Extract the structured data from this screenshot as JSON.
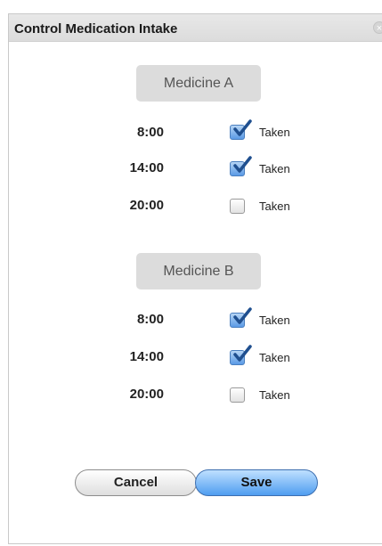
{
  "window": {
    "title": "Control Medication Intake",
    "close_symbol": "×"
  },
  "medicines": [
    {
      "name": "Medicine A",
      "doses": [
        {
          "time": "8:00",
          "label": "Taken",
          "checked": true
        },
        {
          "time": "14:00",
          "label": "Taken",
          "checked": true
        },
        {
          "time": "20:00",
          "label": "Taken",
          "checked": false
        }
      ]
    },
    {
      "name": "Medicine B",
      "doses": [
        {
          "time": "8:00",
          "label": "Taken",
          "checked": true
        },
        {
          "time": "14:00",
          "label": "Taken",
          "checked": true
        },
        {
          "time": "20:00",
          "label": "Taken",
          "checked": false
        }
      ]
    }
  ],
  "buttons": {
    "cancel_label": "Cancel",
    "save_label": "Save"
  },
  "colors": {
    "accent": "#4f9df0",
    "check": "#1f4f8f"
  }
}
